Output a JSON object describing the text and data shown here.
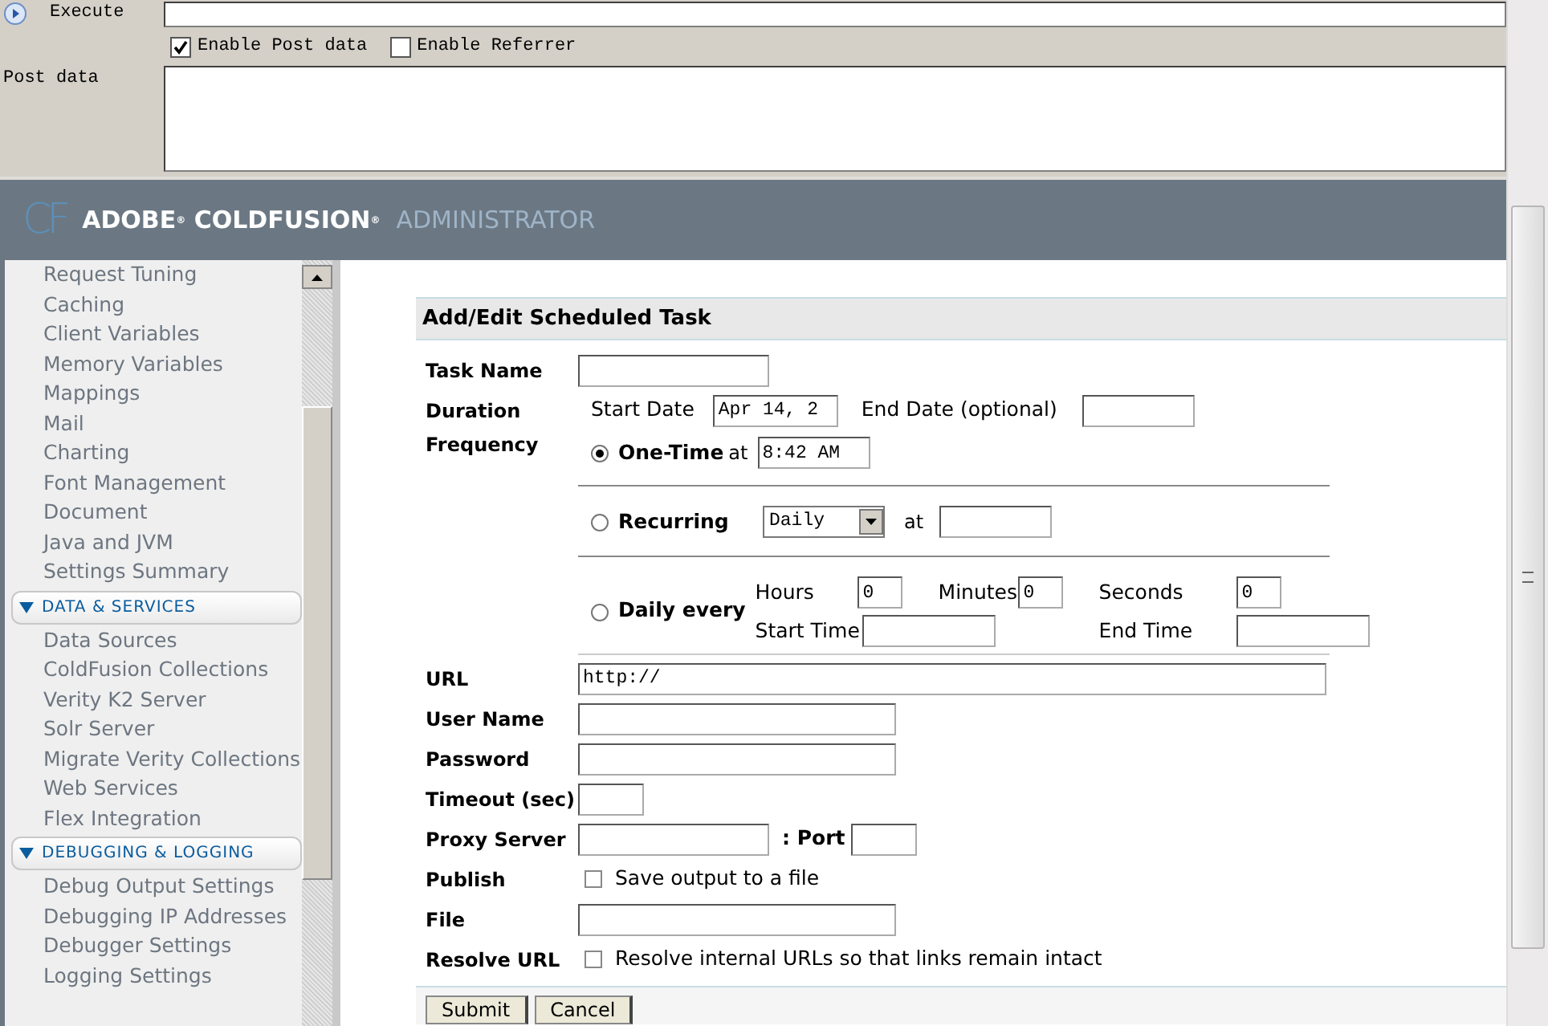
{
  "top_panel": {
    "execute_label": "Execute",
    "checkboxes": [
      {
        "label": "Enable Post data",
        "checked": true
      },
      {
        "label": "Enable Referrer",
        "checked": false
      }
    ],
    "post_data_label": "Post data"
  },
  "header": {
    "logo": "CF",
    "title": "ADOBE$^{®}$ COLDFUSION$^{®}$",
    "subtitle": "ADMINISTRATOR"
  },
  "sidebar": {
    "groups": [
      {
        "items": [
          "Request Tuning",
          "Caching",
          "Client Variables",
          "Memory Variables",
          "Mappings",
          "Mail",
          "Charting",
          "Font Management",
          "Document",
          "Java and JVM",
          "Settings Summary"
        ]
      },
      {
        "title": "DATA & SERVICES",
        "expanded": true,
        "items": [
          "Data Sources",
          "ColdFusion Collections",
          "Verity K2 Server",
          "Solr Server",
          "Migrate Verity Collections",
          "Web Services",
          "Flex Integration"
        ]
      },
      {
        "title": "DEBUGGING & LOGGING",
        "expanded": true,
        "items": [
          "Debug Output Settings",
          "Debugging IP Addresses",
          "Debugger Settings",
          "Logging Settings"
        ]
      }
    ]
  },
  "form": {
    "title": "Add/Edit Scheduled Task",
    "task_name": {
      "label": "Task Name"
    },
    "duration": {
      "label": "Duration",
      "start_label": "Start Date",
      "start_value": "Apr 14, 2",
      "end_label": "End Date (optional)"
    },
    "frequency": {
      "label": "Frequency",
      "options": [
        {
          "kind": "onetime",
          "label": "One-Time",
          "selected": true,
          "at_label": "at",
          "time_value": "8:42 AM"
        },
        {
          "kind": "recurring",
          "label": "Recurring",
          "selected": false,
          "select_value": "Daily",
          "at_label": "at"
        },
        {
          "kind": "daily",
          "label": "Daily every",
          "selected": false,
          "hours_label": "Hours",
          "hours_value": "0",
          "minutes_label": "Minutes",
          "minutes_value": "0",
          "seconds_label": "Seconds",
          "seconds_value": "0",
          "start_label": "Start Time",
          "end_label": "End Time"
        }
      ]
    },
    "url": {
      "label": "URL",
      "value": "http://"
    },
    "user_name": {
      "label": "User Name"
    },
    "password": {
      "label": "Password"
    },
    "timeout": {
      "label": "Timeout (sec)"
    },
    "proxy": {
      "label": "Proxy Server",
      "port_label": ": Port"
    },
    "publish": {
      "label": "Publish",
      "checkbox_label": "Save output to a file",
      "checked": false
    },
    "file": {
      "label": "File"
    },
    "resolve_url": {
      "label": "Resolve URL",
      "checkbox_label": "Resolve internal URLs so that links remain intact",
      "checked": false
    },
    "buttons": [
      "Submit",
      "Cancel"
    ]
  }
}
